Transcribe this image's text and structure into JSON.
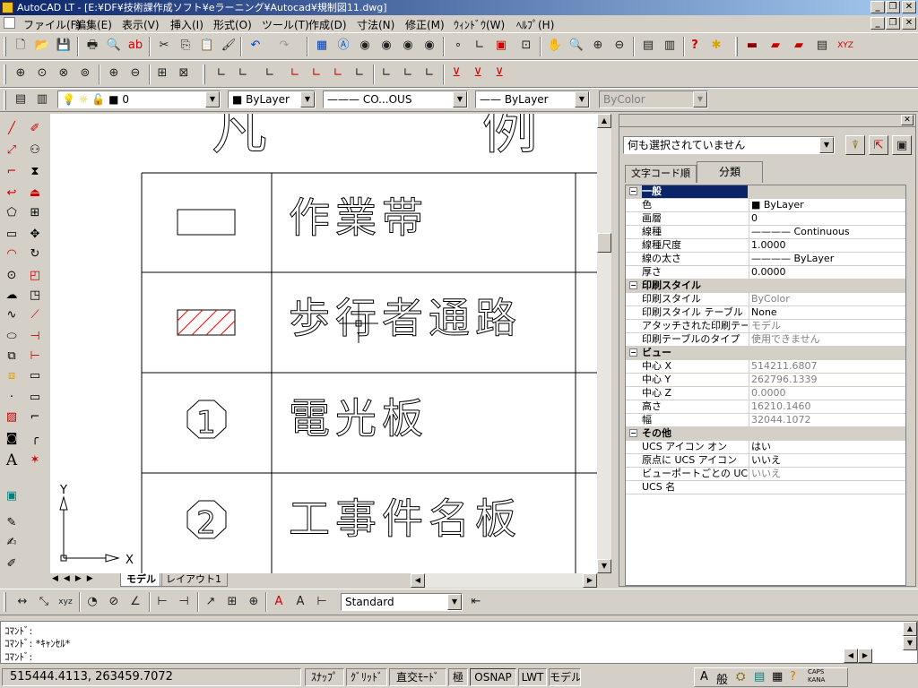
{
  "window": {
    "title": "AutoCAD LT - [E:¥DF¥技術課作成ソフト¥eラーニング¥Autocad¥規制図11.dwg]"
  },
  "menu": [
    "ファイル(F)",
    "編集(E)",
    "表示(V)",
    "挿入(I)",
    "形式(O)",
    "ツール(T)",
    "作成(D)",
    "寸法(N)",
    "修正(M)",
    "ｳｨﾝﾄﾞｳ(W)",
    "ﾍﾙﾌﾟ(H)"
  ],
  "layer_toolbar": {
    "layer": "0",
    "color": "ByLayer",
    "linetype": "CO...OUS",
    "lineweight": "ByLayer",
    "plotstyle": "ByColor"
  },
  "drawing": {
    "header_fragment": "凡 例",
    "legend": [
      {
        "symbol": "rect-empty",
        "label": "作業帯"
      },
      {
        "symbol": "rect-hatched",
        "label": "歩行者通路"
      },
      {
        "symbol": "octagon-1",
        "symbol_text": "1",
        "label": "電光板"
      },
      {
        "symbol": "octagon-2",
        "symbol_text": "2",
        "label": "工事件名板"
      }
    ],
    "ucs_y": "Y",
    "ucs_x": "X"
  },
  "layout_tabs": [
    "モデル",
    "レイアウト1"
  ],
  "properties": {
    "selection": "何も選択されていません",
    "tabs": [
      "文字コード順",
      "分類"
    ],
    "rows": [
      {
        "type": "cat",
        "key": "一般",
        "value": "",
        "sel": true
      },
      {
        "key": "色",
        "value": "■ ByLayer"
      },
      {
        "key": "画層",
        "value": "0"
      },
      {
        "key": "線種",
        "value": "———— Continuous"
      },
      {
        "key": "線種尺度",
        "value": "1.0000"
      },
      {
        "key": "線の太さ",
        "value": "———— ByLayer"
      },
      {
        "key": "厚さ",
        "value": "0.0000"
      },
      {
        "type": "cat",
        "key": "印刷スタイル",
        "value": ""
      },
      {
        "key": "印刷スタイル",
        "value": "ByColor",
        "gray": true
      },
      {
        "key": "印刷スタイル テーブル",
        "value": "None"
      },
      {
        "key": "アタッチされた印刷テーブル",
        "value": "モデル",
        "gray": true
      },
      {
        "key": "印刷テーブルのタイプ",
        "value": "使用できません",
        "gray": true
      },
      {
        "type": "cat",
        "key": "ビュー",
        "value": ""
      },
      {
        "key": "中心 X",
        "value": "514211.6807",
        "gray": true
      },
      {
        "key": "中心 Y",
        "value": "262796.1339",
        "gray": true
      },
      {
        "key": "中心 Z",
        "value": "0.0000",
        "gray": true
      },
      {
        "key": "高さ",
        "value": "16210.1460",
        "gray": true
      },
      {
        "key": "幅",
        "value": "32044.1072",
        "gray": true
      },
      {
        "type": "cat",
        "key": "その他",
        "value": ""
      },
      {
        "key": "UCS アイコン オン",
        "value": "はい"
      },
      {
        "key": "原点に UCS アイコン",
        "value": "いいえ"
      },
      {
        "key": "ビューポートごとの UCS",
        "value": "いいえ",
        "gray": true
      },
      {
        "key": "UCS 名",
        "value": ""
      }
    ]
  },
  "dim_toolbar": {
    "style": "Standard"
  },
  "command": {
    "lines": [
      "ｺﾏﾝﾄﾞ:",
      "ｺﾏﾝﾄﾞ: *ｷｬﾝｾﾙ*",
      "ｺﾏﾝﾄﾞ:"
    ]
  },
  "status": {
    "coords": "515444.4113, 263459.7072",
    "buttons": [
      "ｽﾅｯﾌﾟ",
      "ｸﾞﾘｯﾄﾞ",
      "直交ﾓｰﾄﾞ",
      "極",
      "OSNAP",
      "LWT",
      "モデル"
    ],
    "ime": "般"
  },
  "colors": {
    "titlebar": "#0a246a",
    "hatch": "#ff0000",
    "layer_color": "#000000"
  }
}
